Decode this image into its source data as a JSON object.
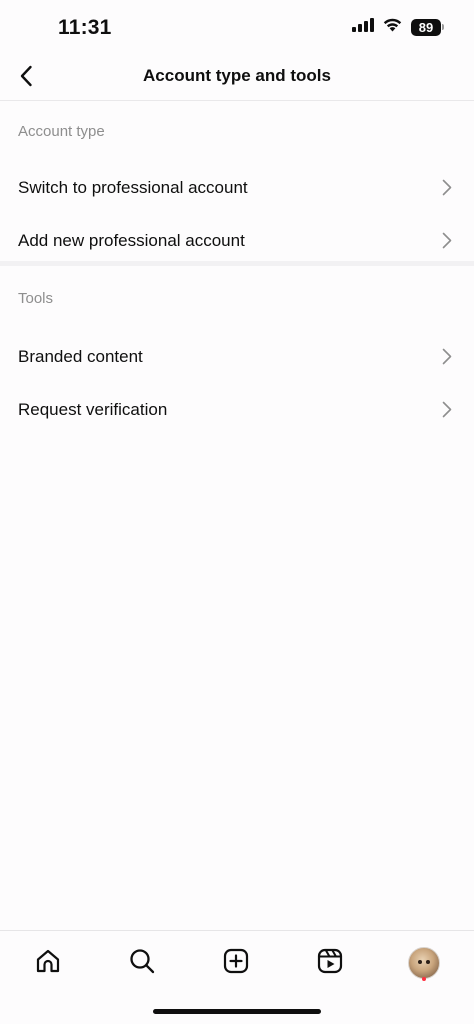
{
  "status_bar": {
    "time": "11:31",
    "battery": "89",
    "icons": [
      "cellular-signal-icon",
      "wifi-icon",
      "battery-icon"
    ]
  },
  "header": {
    "title": "Account type and tools",
    "back_icon": "chevron-left-icon"
  },
  "sections": {
    "account_type": {
      "title": "Account type",
      "items": [
        {
          "label": "Switch to professional account",
          "icon": "chevron-right-icon"
        },
        {
          "label": "Add new professional account",
          "icon": "chevron-right-icon"
        }
      ]
    },
    "tools": {
      "title": "Tools",
      "items": [
        {
          "label": "Branded content",
          "icon": "chevron-right-icon"
        },
        {
          "label": "Request verification",
          "icon": "chevron-right-icon"
        }
      ]
    }
  },
  "tab_bar": {
    "items": [
      {
        "name": "home",
        "icon": "home-icon"
      },
      {
        "name": "search",
        "icon": "search-icon"
      },
      {
        "name": "create",
        "icon": "plus-square-icon"
      },
      {
        "name": "reels",
        "icon": "reels-icon"
      },
      {
        "name": "profile",
        "icon": "avatar"
      }
    ]
  },
  "colors": {
    "background": "#fdfcfd",
    "text": "#0f0f0f",
    "section_header": "#8e8e8e",
    "notification_dot": "#ff3040"
  }
}
